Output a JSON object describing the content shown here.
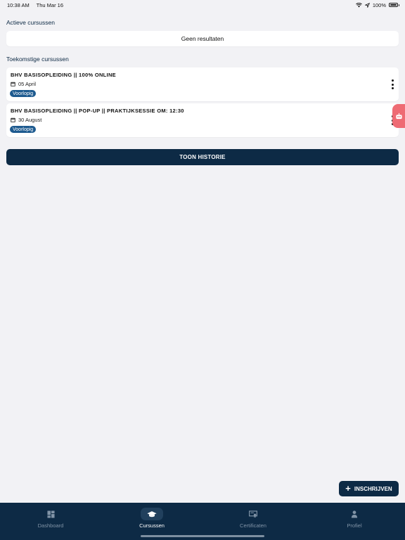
{
  "status_bar": {
    "time": "10:38 AM",
    "date": "Thu Mar 16",
    "battery": "100%"
  },
  "active_courses": {
    "title": "Actieve cursussen",
    "empty_text": "Geen resultaten"
  },
  "upcoming_courses": {
    "title": "Toekomstige cursussen",
    "items": [
      {
        "title": "BHV BASISOPLEIDING || 100% ONLINE",
        "date": "05 April",
        "status": "Voorlopig"
      },
      {
        "title": "BHV BASISOPLEIDING || POP-UP || PRAKTIJKSESSIE OM: 12:30",
        "date": "30 August",
        "status": "Voorlopig"
      }
    ]
  },
  "history_button": {
    "label": "TOON HISTORIE"
  },
  "enroll_button": {
    "label": "INSCHRIJVEN",
    "icon": "plus-icon"
  },
  "tab_bar": {
    "tabs": [
      {
        "label": "Dashboard",
        "icon": "dashboard-icon",
        "active": false
      },
      {
        "label": "Cursussen",
        "icon": "graduation-cap-icon",
        "active": true
      },
      {
        "label": "Certificaten",
        "icon": "certificate-icon",
        "active": false
      },
      {
        "label": "Profiel",
        "icon": "person-icon",
        "active": false
      }
    ]
  },
  "colors": {
    "primary": "#0d2a45",
    "badge": "#1d5a8f",
    "background": "#f2f2f5",
    "side_tab": "#ee6b74"
  }
}
